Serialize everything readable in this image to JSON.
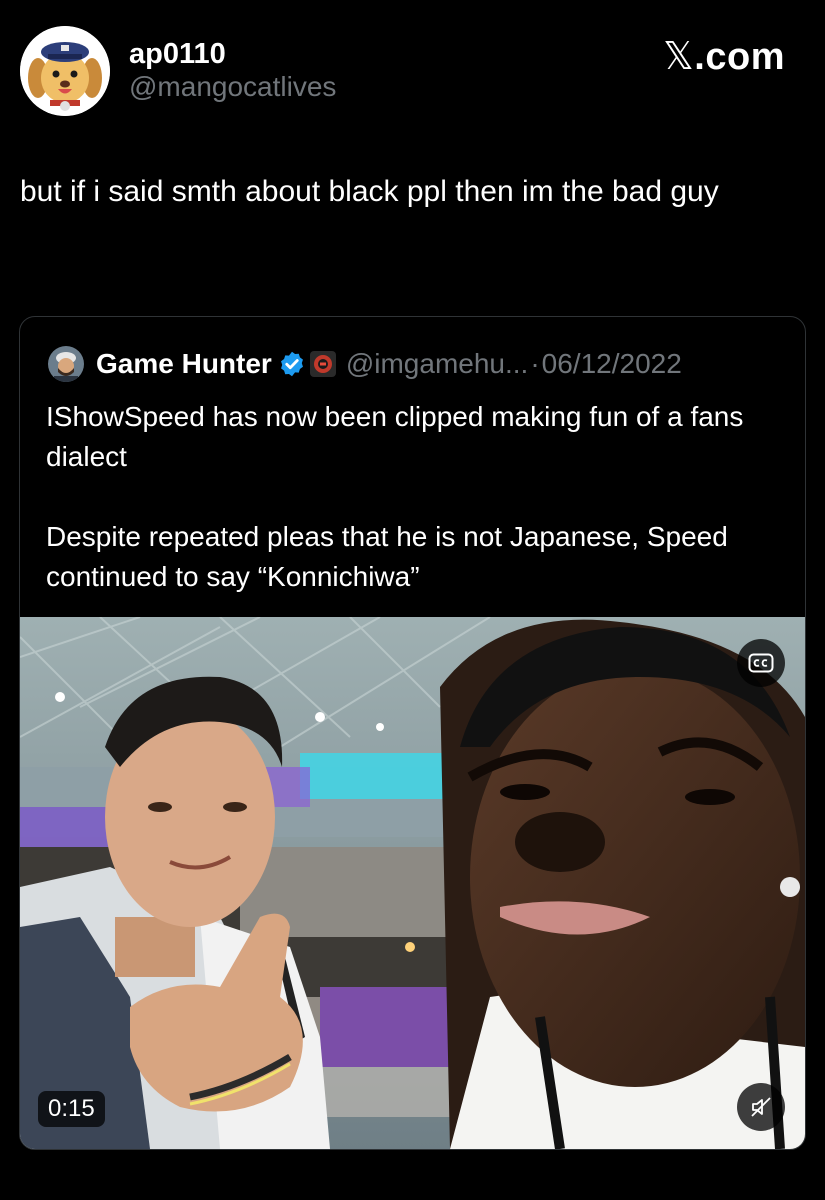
{
  "tweet": {
    "author": {
      "display_name": "ap0110",
      "handle": "@mangocatlives",
      "avatar_icon": "dog-cartoon-avatar-icon"
    },
    "brand": {
      "x": "𝕏",
      "suffix": ".com"
    },
    "text": "but if i said smth about black ppl then im the bad guy"
  },
  "quoted_tweet": {
    "author": {
      "display_name": "Game Hunter",
      "handle": "@imgamehu...",
      "verified": true,
      "avatar_icon": "person-avatar-icon",
      "affiliate_icon": "affiliate-badge-icon"
    },
    "separator": "·",
    "date": "06/12/2022",
    "paragraphs": [
      "IShowSpeed has now been clipped making fun of a fans dialect",
      "Despite repeated pleas that he is not Japanese, Speed continued to say “Konnichiwa”"
    ],
    "video": {
      "duration": "0:15",
      "captions_icon": "cc-icon",
      "mute_icon": "speaker-muted-icon"
    }
  },
  "colors": {
    "background": "#000000",
    "text_primary": "#ffffff",
    "text_secondary": "#71767b",
    "border": "#2f3336",
    "verified_blue": "#1d9bf0"
  }
}
